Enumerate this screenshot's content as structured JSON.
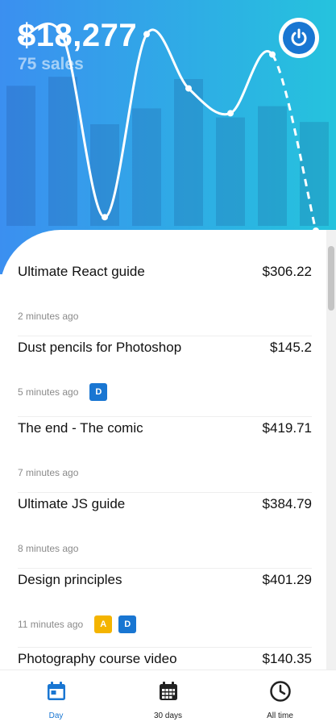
{
  "header": {
    "total": "$18,277",
    "sales_count": "75 sales"
  },
  "hero_chart": {
    "bar_heights_fraction": [
      0.62,
      0.66,
      0.45,
      0.52,
      0.65,
      0.48,
      0.53,
      0.46
    ],
    "line_values": [
      0.9,
      0.91,
      0.11,
      0.92,
      0.68,
      0.57,
      0.83,
      0.05
    ],
    "dashed_from_index": 6
  },
  "sales": [
    {
      "title": "Ultimate React guide",
      "price": "$306.22",
      "time": "2 minutes ago",
      "badges": []
    },
    {
      "title": "Dust pencils for Photoshop",
      "price": "$145.2",
      "time": "5 minutes ago",
      "badges": [
        {
          "letter": "D",
          "color": "#1976d2"
        }
      ]
    },
    {
      "title": "The end - The comic",
      "price": "$419.71",
      "time": "7 minutes ago",
      "badges": []
    },
    {
      "title": "Ultimate JS guide",
      "price": "$384.79",
      "time": "8 minutes ago",
      "badges": []
    },
    {
      "title": "Design principles",
      "price": "$401.29",
      "time": "11 minutes ago",
      "badges": [
        {
          "letter": "A",
          "color": "#f4b400"
        },
        {
          "letter": "D",
          "color": "#1976d2"
        }
      ]
    },
    {
      "title": "Photography course video",
      "price": "$140.35",
      "time": "",
      "badges": []
    }
  ],
  "tabs": [
    {
      "label": "Day",
      "icon": "calendar-day-icon",
      "active": true
    },
    {
      "label": "30 days",
      "icon": "calendar-month-icon",
      "active": false
    },
    {
      "label": "All time",
      "icon": "clock-icon",
      "active": false
    }
  ],
  "colors": {
    "gradient_start": "#3b8ff0",
    "gradient_end": "#25c3dd",
    "accent": "#1976d2",
    "badge_yellow": "#f4b400"
  }
}
